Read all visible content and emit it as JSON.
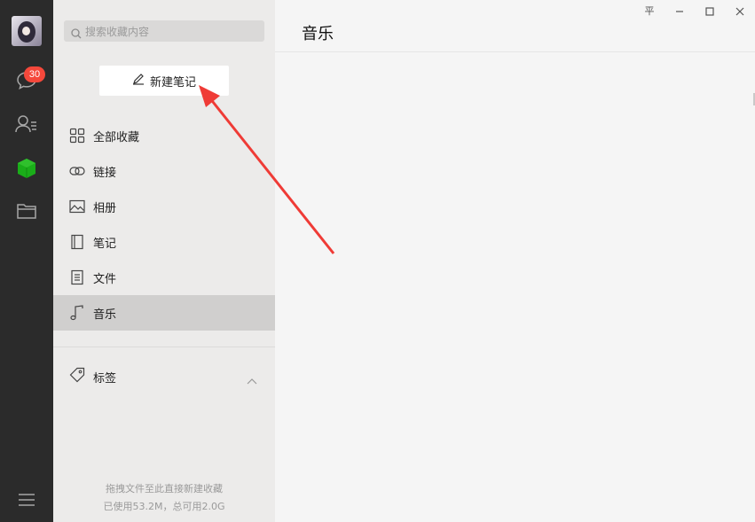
{
  "sidebar": {
    "badge_count": "30",
    "icons": [
      "chat-icon",
      "contacts-icon",
      "favorites-cube-icon",
      "folder-icon",
      "menu-icon"
    ]
  },
  "panel": {
    "search_placeholder": "搜索收藏内容",
    "new_note_label": "新建笔记",
    "items": [
      {
        "label": "全部收藏",
        "icon": "grid-icon"
      },
      {
        "label": "链接",
        "icon": "link-icon"
      },
      {
        "label": "相册",
        "icon": "image-icon"
      },
      {
        "label": "笔记",
        "icon": "notebook-icon"
      },
      {
        "label": "文件",
        "icon": "file-icon"
      },
      {
        "label": "音乐",
        "icon": "music-icon",
        "active": true
      }
    ],
    "tags_label": "标签",
    "footer_line1": "拖拽文件至此直接新建收藏",
    "footer_line2": "已使用53.2M，总可用2.0G"
  },
  "main": {
    "title": "音乐",
    "pin_glyph": "平"
  },
  "colors": {
    "sidebar_bg": "#2b2b2b",
    "badge_red": "#f5483b",
    "favorites_green": "#1aad19",
    "active_item_bg": "#d0cfce",
    "arrow_red": "#ef3b36"
  }
}
